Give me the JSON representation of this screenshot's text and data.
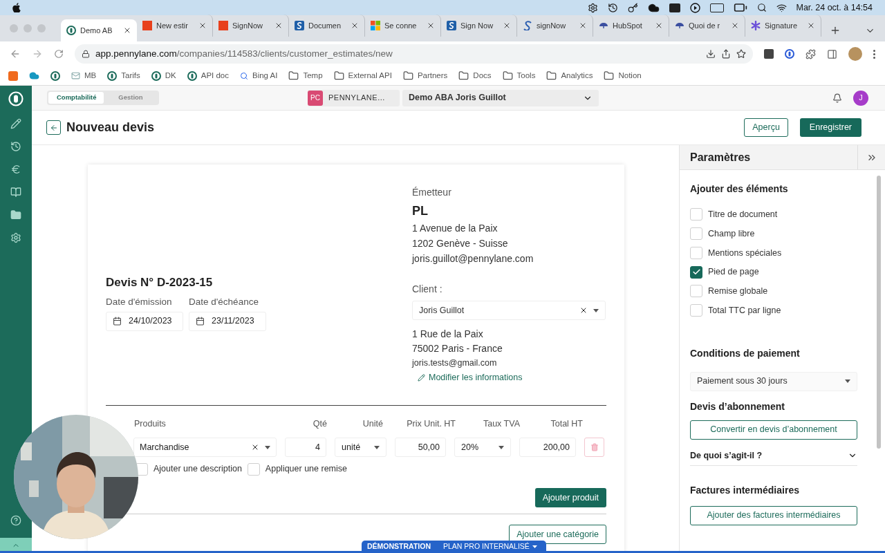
{
  "menubar": {
    "clock": "Mar. 24 oct. à 14:54"
  },
  "browser_tabs": [
    {
      "title": "Demo AB",
      "kind": "pennylane",
      "selected": true
    },
    {
      "title": "New estir",
      "kind": "red",
      "selected": false
    },
    {
      "title": "SignNow",
      "kind": "red",
      "selected": false
    },
    {
      "title": "Documen",
      "kind": "signnow",
      "selected": false
    },
    {
      "title": "Se conne",
      "kind": "microsoft",
      "selected": false
    },
    {
      "title": "Sign Now",
      "kind": "signnow",
      "selected": false
    },
    {
      "title": "signNow",
      "kind": "script",
      "selected": false
    },
    {
      "title": "HubSpot",
      "kind": "umbrella",
      "selected": false
    },
    {
      "title": "Quoi de r",
      "kind": "umbrella",
      "selected": false
    },
    {
      "title": "Signature",
      "kind": "star",
      "selected": false
    }
  ],
  "address_bar": {
    "domain": "app.pennylane.com",
    "path": "/companies/114583/clients/customer_estimates/new"
  },
  "bookmarks": [
    {
      "kind": "orange"
    },
    {
      "kind": "cloud"
    },
    {
      "kind": "pennylane"
    },
    {
      "label": "MB",
      "kind": "mail"
    },
    {
      "label": "Tarifs",
      "kind": "pennylane"
    },
    {
      "label": "DK",
      "kind": "pennylane"
    },
    {
      "label": "API doc",
      "kind": "pennylane"
    },
    {
      "label": "Bing AI",
      "kind": "search"
    },
    {
      "label": "Temp",
      "kind": "folder"
    },
    {
      "label": "External API",
      "kind": "folder"
    },
    {
      "label": "Partners",
      "kind": "folder"
    },
    {
      "label": "Docs",
      "kind": "folder"
    },
    {
      "label": "Tools",
      "kind": "folder"
    },
    {
      "label": "Analytics",
      "kind": "folder"
    },
    {
      "label": "Notion",
      "kind": "folder"
    }
  ],
  "topbar": {
    "modes": [
      {
        "label": "Comptabilité",
        "selected": true
      },
      {
        "label": "Gestion",
        "selected": false
      }
    ],
    "company_badge": "PC",
    "company": "PENNYLANE...",
    "account": "Demo ABA Joris Guillot",
    "avatar": "J"
  },
  "header": {
    "title": "Nouveau devis",
    "preview_button": "Aperçu",
    "save_button": "Enregistrer"
  },
  "document": {
    "emitter_label": "Émetteur",
    "emitter_name": "PL",
    "emitter_lines": [
      "1 Avenue de la Paix",
      "1202 Genève - Suisse",
      "joris.guillot@pennylane.com"
    ],
    "title": "Devis N° D-2023-15",
    "dates": [
      {
        "label": "Date d'émission",
        "value": "24/10/2023"
      },
      {
        "label": "Date d'échéance",
        "value": "23/11/2023"
      }
    ],
    "client_label": "Client :",
    "client": "Joris Guillot",
    "client_lines": [
      "1 Rue de la Paix",
      "75002 Paris - France",
      "joris.tests@gmail.com"
    ],
    "edit_link": "Modifier les informations",
    "columns": [
      "Produits",
      "Qté",
      "Unité",
      "Prix Unit. HT",
      "Taux TVA",
      "Total HT"
    ],
    "rows": [
      {
        "product": "Marchandise",
        "qty": "4",
        "unit": "unité",
        "price": "50,00",
        "vat": "20%",
        "total": "200,00"
      }
    ],
    "row_options": [
      {
        "label": "Ajouter une description",
        "checked": false
      },
      {
        "label": "Appliquer une remise",
        "checked": false
      }
    ],
    "add_product": "Ajouter produit",
    "add_category": "Ajouter une catégorie"
  },
  "settings": {
    "title": "Paramètres",
    "elements_title": "Ajouter des éléments",
    "elements": [
      {
        "label": "Titre de document",
        "checked": false
      },
      {
        "label": "Champ libre",
        "checked": false
      },
      {
        "label": "Mentions spéciales",
        "checked": false
      },
      {
        "label": "Pied de page",
        "checked": true
      },
      {
        "label": "Remise globale",
        "checked": false
      },
      {
        "label": "Total TTC par ligne",
        "checked": false
      }
    ],
    "payment_title": "Conditions de paiement",
    "payment_value": "Paiement sous 30 jours",
    "subscription_title": "Devis d’abonnement",
    "subscription_button": "Convertir en devis d’abonnement",
    "faq": {
      "label": "De quoi s’agit-il ?",
      "expanded": false
    },
    "interim_title": "Factures intermédiaires",
    "interim_button": "Ajouter des factures intermédiaires"
  },
  "banner": {
    "label": "DÉMONSTRATION",
    "plan": "PLAN PRO INTERNALISÉ"
  }
}
